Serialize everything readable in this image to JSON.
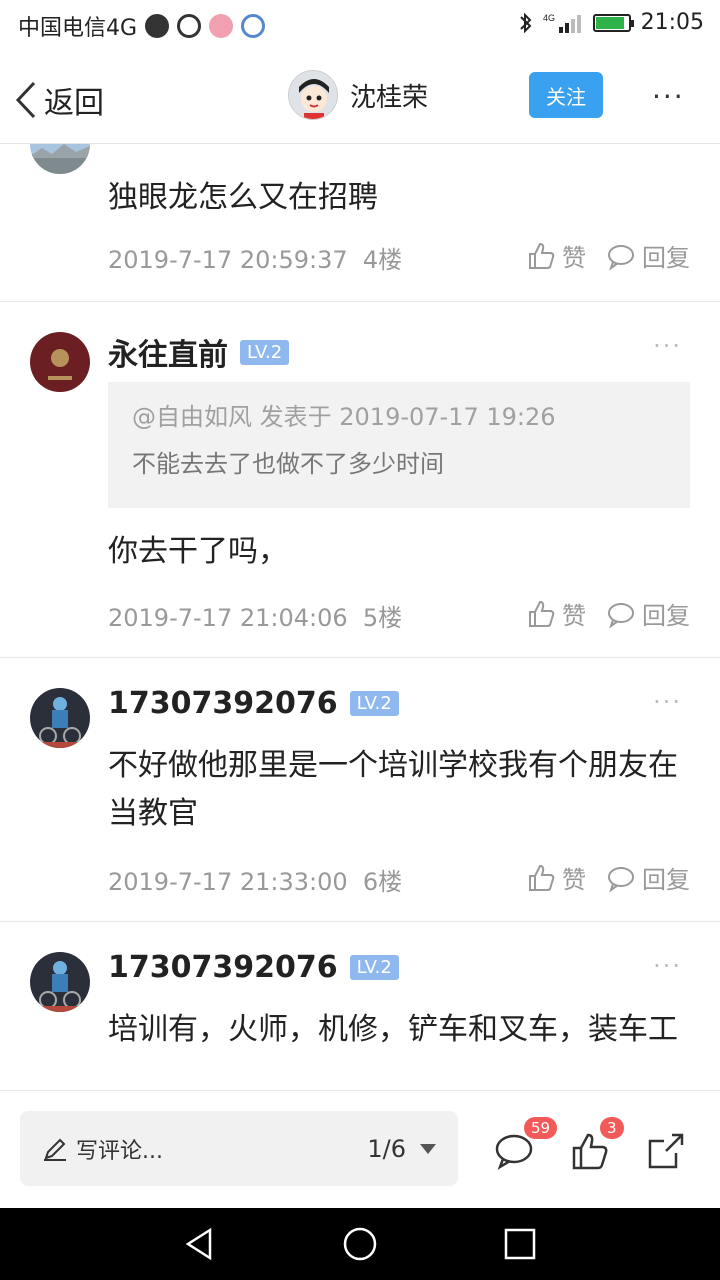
{
  "status_bar": {
    "carrier": "中国电信4G",
    "time": "21:05",
    "battery_level": 0.85,
    "network": "4G",
    "icons": [
      "qq-icon",
      "k-icon",
      "app-icon",
      "app-icon-2",
      "bluetooth-icon",
      "signal-icon",
      "battery-icon"
    ]
  },
  "nav": {
    "back_label": "返回",
    "user_name": "沈桂荣",
    "follow_label": "关注",
    "more": "···"
  },
  "posts": [
    {
      "user": "",
      "level": "",
      "content": "独眼龙怎么又在招聘",
      "datetime": "2019-7-17 20:59:37",
      "floor": "4楼",
      "like_label": "赞",
      "reply_label": "回复"
    },
    {
      "user": "永往直前",
      "level": "LV.2",
      "quote": {
        "head": "@自由如风 发表于 2019-07-17 19:26",
        "text": "不能去去了也做不了多少时间"
      },
      "content": "你去干了吗，",
      "datetime": "2019-7-17 21:04:06",
      "floor": "5楼",
      "like_label": "赞",
      "reply_label": "回复"
    },
    {
      "user": "17307392076",
      "level": "LV.2",
      "content": "不好做他那里是一个培训学校我有个朋友在当教官",
      "datetime": "2019-7-17 21:33:00",
      "floor": "6楼",
      "like_label": "赞",
      "reply_label": "回复"
    },
    {
      "user": "17307392076",
      "level": "LV.2",
      "content": "培训有，火师，机修，铲车和叉车，装车工"
    }
  ],
  "bottom_bar": {
    "comment_placeholder": "写评论...",
    "page_indicator": "1/6",
    "comment_count": "59",
    "like_count": "3"
  },
  "colors": {
    "accent": "#3aa1f0",
    "level_badge": "#8fb9ee",
    "count_badge": "#f25a5a",
    "meta_text": "#999999"
  }
}
